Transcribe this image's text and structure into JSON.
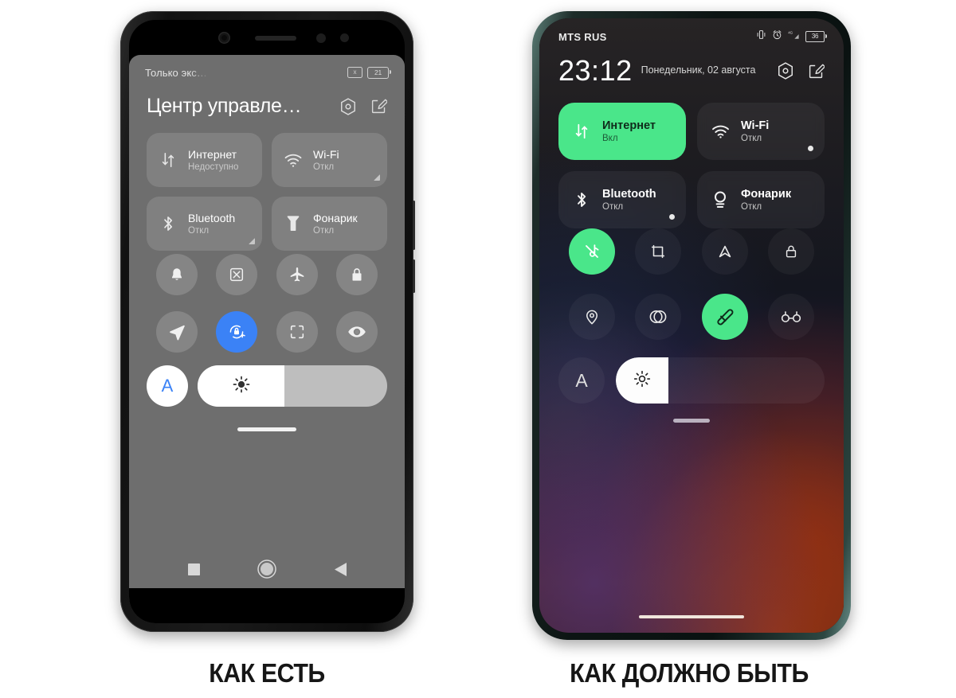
{
  "captions": {
    "left": "КАК ЕСТЬ",
    "right": "КАК ДОЛЖНО БЫТЬ"
  },
  "left_phone": {
    "status_bar": {
      "carrier": "Только экс…",
      "no_sim_icon": "x",
      "battery_percent": "21"
    },
    "panel_title": "Центр управле…",
    "header_icons": [
      {
        "name": "settings-hex-icon"
      },
      {
        "name": "edit-icon"
      }
    ],
    "tiles": [
      {
        "label": "Интернет",
        "status": "Недоступно",
        "icon": "data-transfer-icon",
        "active": false,
        "corner": false
      },
      {
        "label": "Wi-Fi",
        "status": "Откл",
        "icon": "wifi-icon",
        "active": false,
        "corner": true
      },
      {
        "label": "Bluetooth",
        "status": "Откл",
        "icon": "bluetooth-icon",
        "active": false,
        "corner": true
      },
      {
        "label": "Фонарик",
        "status": "Откл",
        "icon": "flashlight-icon",
        "active": false,
        "corner": false
      }
    ],
    "toggles": [
      {
        "icon": "bell-icon",
        "active": false
      },
      {
        "icon": "screenshot-scissors-icon",
        "active": false
      },
      {
        "icon": "airplane-icon",
        "active": false
      },
      {
        "icon": "lock-icon",
        "active": false
      },
      {
        "icon": "location-arrow-icon",
        "active": false
      },
      {
        "icon": "rotation-lock-icon",
        "active": true
      },
      {
        "icon": "scan-frame-icon",
        "active": false
      },
      {
        "icon": "eye-icon",
        "active": false
      }
    ],
    "brightness": {
      "auto_label": "A",
      "fill_percent": 46,
      "icon": "sun-brightness-icon"
    },
    "nav_bar": [
      {
        "icon": "recents-square-icon"
      },
      {
        "icon": "home-circle-icon"
      },
      {
        "icon": "back-triangle-icon"
      }
    ],
    "accent_color": "#3b82f6"
  },
  "right_phone": {
    "status_bar": {
      "carrier": "MTS RUS",
      "icons": [
        "vibrate-icon",
        "alarm-icon",
        "signal-4g-icon"
      ],
      "battery_percent": "36"
    },
    "clock": {
      "time": "23:12",
      "date": "Понедельник, 02 августа"
    },
    "header_icons": [
      {
        "name": "settings-hex-icon"
      },
      {
        "name": "edit-icon"
      }
    ],
    "tiles": [
      {
        "label": "Интернет",
        "status": "Вкл",
        "icon": "data-transfer-icon",
        "active": true,
        "dot": false
      },
      {
        "label": "Wi-Fi",
        "status": "Откл",
        "icon": "wifi-icon",
        "active": false,
        "dot": true
      },
      {
        "label": "Bluetooth",
        "status": "Откл",
        "icon": "bluetooth-icon",
        "active": false,
        "dot": true
      },
      {
        "label": "Фонарик",
        "status": "Откл",
        "icon": "flashlight-icon",
        "active": false,
        "dot": false
      }
    ],
    "toggles": [
      {
        "icon": "sound-off-icon",
        "active": true
      },
      {
        "icon": "screenshot-crop-icon",
        "active": false
      },
      {
        "icon": "location-arrow-icon",
        "active": false
      },
      {
        "icon": "lock-icon",
        "active": false
      },
      {
        "icon": "location-pin-icon",
        "active": false
      },
      {
        "icon": "contrast-icon",
        "active": false
      },
      {
        "icon": "screen-record-icon",
        "active": true
      },
      {
        "icon": "reading-glasses-icon",
        "active": false
      }
    ],
    "brightness": {
      "auto_label": "A",
      "fill_percent": 25,
      "icon": "sun-brightness-icon"
    },
    "accent_color": "#4ae68a"
  }
}
